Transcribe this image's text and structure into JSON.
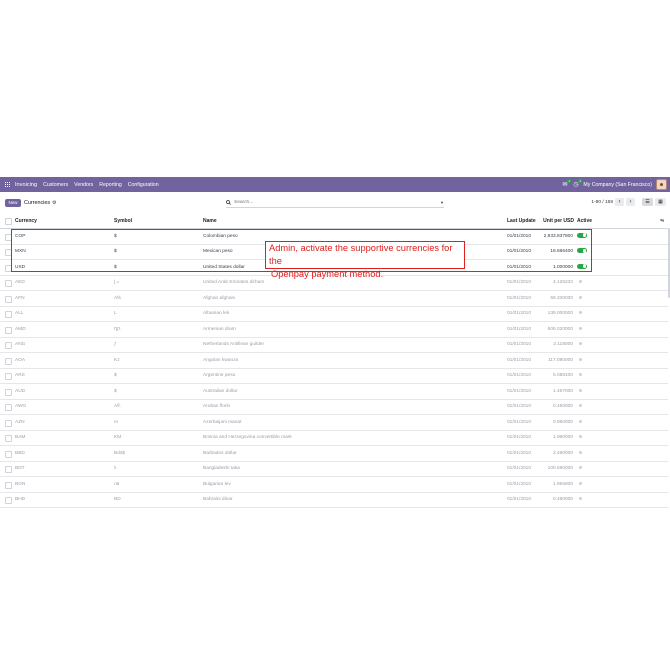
{
  "navbar": {
    "app_name": "Invoicing",
    "menus": [
      "Customers",
      "Vendors",
      "Reporting",
      "Configuration"
    ],
    "messages_badge": "1",
    "activity_badge": "2",
    "company": "My Company (San Francisco)",
    "colors": {
      "bar": "#71639e"
    }
  },
  "control_panel": {
    "new_label": "New",
    "title": "Currencies",
    "search_placeholder": "Search...",
    "pager": "1-80 / 169"
  },
  "table": {
    "columns": [
      "Currency",
      "Symbol",
      "Name",
      "Last Update",
      "Unit per USD",
      "Active"
    ],
    "rows": [
      {
        "code": "COP",
        "symbol": "$",
        "name": "Colombian peso",
        "last_update": "01/01/2010",
        "rate": "2,933.837800",
        "active": true
      },
      {
        "code": "MXN",
        "symbol": "$",
        "name": "Mexican peso",
        "last_update": "01/01/2010",
        "rate": "18.666400",
        "active": true
      },
      {
        "code": "USD",
        "symbol": "$",
        "name": "United States dollar",
        "last_update": "01/01/2010",
        "rate": "1.000000",
        "active": true
      },
      {
        "code": "AED",
        "symbol": "د.إ",
        "name": "United Arab Emirates dirham",
        "last_update": "01/01/2010",
        "rate": "4.125232",
        "active": false
      },
      {
        "code": "AFN",
        "symbol": "Afs",
        "name": "Afghan afghani",
        "last_update": "01/01/2010",
        "rate": "59.330000",
        "active": false
      },
      {
        "code": "ALL",
        "symbol": "L",
        "name": "Albanian lek",
        "last_update": "01/01/2010",
        "rate": "138.000000",
        "active": false
      },
      {
        "code": "AMD",
        "symbol": "դր.",
        "name": "Armenian dram",
        "last_update": "01/01/2010",
        "rate": "506.020000",
        "active": false
      },
      {
        "code": "ANG",
        "symbol": "ƒ",
        "name": "Netherlands Antillean guilder",
        "last_update": "01/01/2010",
        "rate": "2.118000",
        "active": false
      },
      {
        "code": "AOA",
        "symbol": "Kz",
        "name": "Angolan kwanza",
        "last_update": "01/01/2010",
        "rate": "117.080000",
        "active": false
      },
      {
        "code": "ARS",
        "symbol": "$",
        "name": "Argentine peso",
        "last_update": "01/01/2010",
        "rate": "5.088100",
        "active": false
      },
      {
        "code": "AUD",
        "symbol": "$",
        "name": "Australian dollar",
        "last_update": "01/01/2010",
        "rate": "1.467000",
        "active": false
      },
      {
        "code": "AWG",
        "symbol": "Afl.",
        "name": "Aruban florin",
        "last_update": "01/01/2010",
        "rate": "0.450000",
        "active": false
      },
      {
        "code": "AZN",
        "symbol": "m",
        "name": "Azerbaijani manat",
        "last_update": "01/01/2010",
        "rate": "0.960000",
        "active": false
      },
      {
        "code": "BAM",
        "symbol": "KM",
        "name": "Bosnia and Herzegovina convertible mark",
        "last_update": "01/01/2010",
        "rate": "1.960000",
        "active": false
      },
      {
        "code": "BBD",
        "symbol": "Bds$",
        "name": "Barbados dollar",
        "last_update": "01/01/2010",
        "rate": "2.460000",
        "active": false
      },
      {
        "code": "BDT",
        "symbol": "৳",
        "name": "Bangladeshi taka",
        "last_update": "01/01/2010",
        "rate": "100.590000",
        "active": false
      },
      {
        "code": "BGN",
        "symbol": "лв",
        "name": "Bulgarian lev",
        "last_update": "01/01/2010",
        "rate": "1.955800",
        "active": false
      },
      {
        "code": "BHD",
        "symbol": "BD",
        "name": "Bahraini dinar",
        "last_update": "01/01/2010",
        "rate": "0.460000",
        "active": false
      }
    ]
  },
  "annotation": {
    "line1": "Admin, activate the supportive currencies for the",
    "line2": "Openpay payment method.",
    "color": "#e02020"
  }
}
